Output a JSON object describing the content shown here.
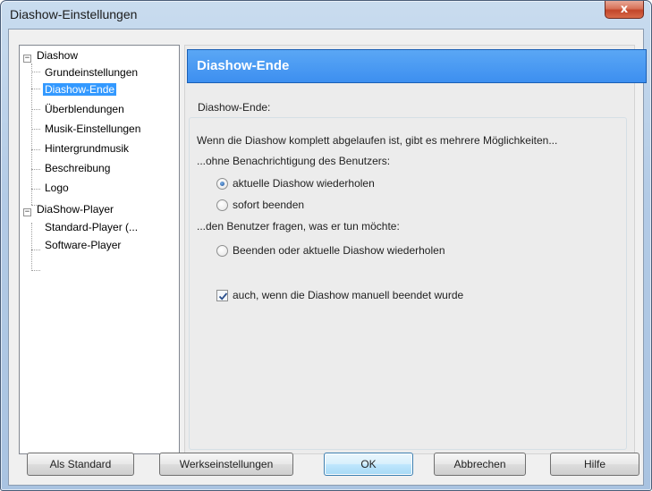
{
  "window": {
    "title": "Diashow-Einstellungen",
    "close_glyph": "x"
  },
  "tree": {
    "items": [
      {
        "label": "Diashow",
        "expander": "−"
      },
      {
        "label": "Grundeinstellungen"
      },
      {
        "label": "Diashow-Ende"
      },
      {
        "label": "Überblendungen"
      },
      {
        "label": "Musik-Einstellungen"
      },
      {
        "label": "Hintergrundmusik"
      },
      {
        "label": "Beschreibung"
      },
      {
        "label": "Logo"
      },
      {
        "label": "DiaShow-Player",
        "expander": "−"
      },
      {
        "label": "Standard-Player (..."
      },
      {
        "label": "Software-Player"
      }
    ],
    "selected": "Diashow-Ende"
  },
  "panel": {
    "header": "Diashow-Ende",
    "group_title": "Diashow-Ende:",
    "intro": "Wenn die Diashow komplett abgelaufen ist, gibt es mehrere Möglichkeiten...",
    "section1": "...ohne Benachrichtigung des Benutzers:",
    "radio_repeat": "aktuelle Diashow wiederholen",
    "radio_end": "sofort beenden",
    "section2": "...den Benutzer fragen, was er tun möchte:",
    "radio_ask": "Beenden oder aktuelle Diashow wiederholen",
    "checkbox_manual": "auch, wenn die Diashow manuell beendet wurde",
    "selected_radio": "aktuelle Diashow wiederholen",
    "checkbox_checked": true
  },
  "buttons": {
    "default_label": "Als Standard",
    "factory_label": "Werkseinstellungen",
    "ok_label": "OK",
    "cancel_label": "Abbrechen",
    "help_label": "Hilfe"
  },
  "colors": {
    "header_bg": "#3d8ff0",
    "selection": "#3399ff"
  }
}
